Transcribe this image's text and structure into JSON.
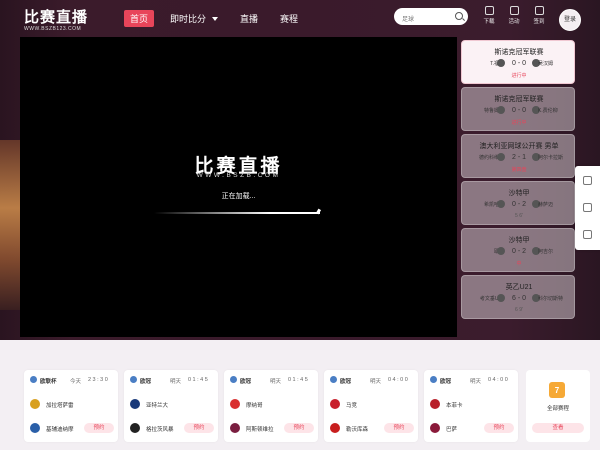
{
  "header": {
    "logo_cn": "比赛直播",
    "logo_en": "WWW.BSZB123.COM",
    "nav": [
      {
        "label": "首页",
        "active": true
      },
      {
        "label": "即时比分",
        "active": false
      },
      {
        "label": "直播",
        "active": false
      },
      {
        "label": "赛程",
        "active": false
      }
    ],
    "search_placeholder": "足球",
    "icons": [
      {
        "label": "下载",
        "icon": "download-icon"
      },
      {
        "label": "活动",
        "icon": "gift-icon"
      },
      {
        "label": "签到",
        "icon": "checkin-icon"
      }
    ],
    "login_label": "登录"
  },
  "player": {
    "brand_cn": "比赛直播",
    "brand_en": "WWW.BSZB.COM",
    "loading_text": "正在加载..."
  },
  "matches": [
    {
      "league": "斯诺克冠军联赛",
      "home": "T.福特",
      "score": "0 - 0",
      "away": "吴汉姆",
      "status": "进行中",
      "sub": ""
    },
    {
      "league": "斯诺克冠军联赛",
      "home": "特鲁姆普",
      "score": "0 - 0",
      "away": "K.费伦柳",
      "status": "进行中",
      "sub": ""
    },
    {
      "league": "澳大利亚网球公开赛    男单",
      "home": "德约科维奇",
      "score": "2 - 1",
      "away": "阿尔卡拉斯",
      "status": "第四盘",
      "sub": ""
    },
    {
      "league": "沙特甲",
      "home": "希凯哈巴",
      "score": "0 - 2",
      "away": "赫萨迈",
      "status": "",
      "sub": "5  6'"
    },
    {
      "league": "沙特甲",
      "home": "耶萨",
      "score": "0 - 2",
      "away": "阿吉尔",
      "status": "中",
      "sub": ""
    },
    {
      "league": "英乙U21",
      "home": "考文垂U21",
      "score": "6 - 0",
      "away": "科尔切斯特",
      "status": "",
      "sub": "6  9'"
    }
  ],
  "schedule": [
    {
      "league": "欧联杯",
      "day": "今天",
      "time": "23:30",
      "home": "加拉塔萨雷",
      "away": "基辅迪纳摩",
      "home_color": "#d8a020",
      "away_color": "#2a5fa8",
      "btn": "预约"
    },
    {
      "league": "欧冠",
      "day": "明天",
      "time": "01:45",
      "home": "亚特兰大",
      "away": "格拉茨风暴",
      "home_color": "#1a3a7a",
      "away_color": "#222222",
      "btn": "预约"
    },
    {
      "league": "欧冠",
      "day": "明天",
      "time": "01:45",
      "home": "摩纳哥",
      "away": "阿斯顿维拉",
      "home_color": "#d93030",
      "away_color": "#7a1e40",
      "btn": "预约"
    },
    {
      "league": "欧冠",
      "day": "明天",
      "time": "04:00",
      "home": "马竞",
      "away": "勒沃库森",
      "home_color": "#c8202c",
      "away_color": "#c81e1e",
      "btn": "预约"
    },
    {
      "league": "欧冠",
      "day": "明天",
      "time": "04:00",
      "home": "本菲卡",
      "away": "巴萨",
      "home_color": "#b8202a",
      "away_color": "#8a1a3a",
      "btn": "预约"
    }
  ],
  "all_schedule": {
    "calendar_day": "7",
    "label": "全部赛程",
    "btn": "查看"
  },
  "colors": {
    "accent": "#e8455a",
    "dark_bg": "#3a1a2b",
    "calendar": "#f6a936"
  }
}
